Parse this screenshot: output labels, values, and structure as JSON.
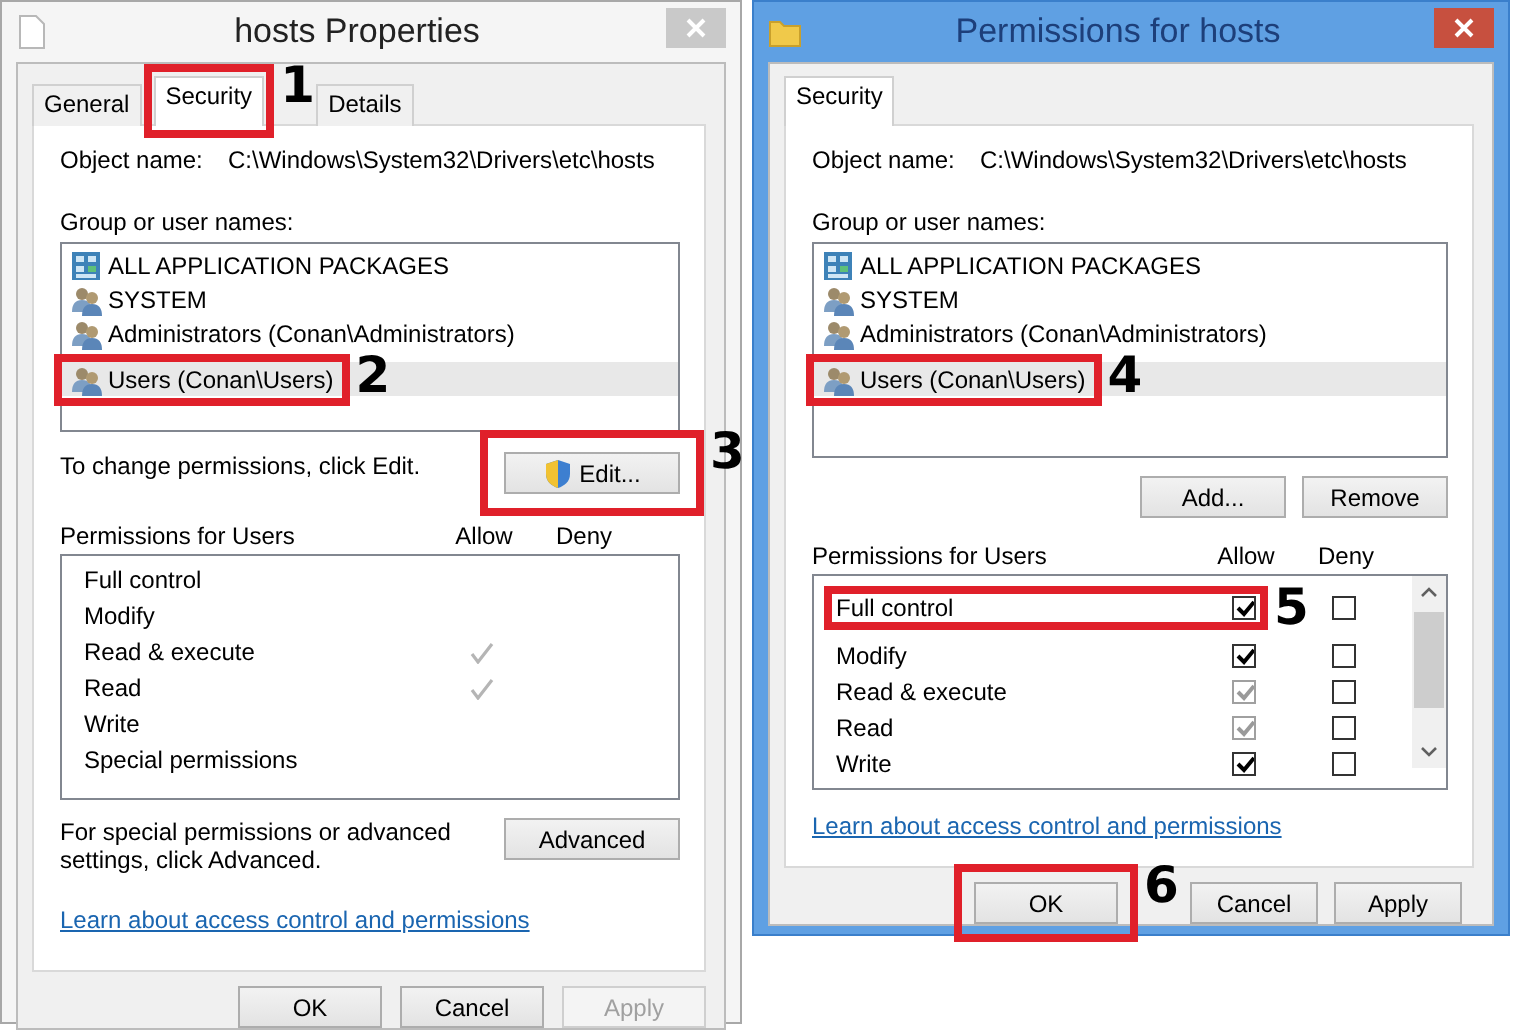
{
  "windows": [
    {
      "kind": "properties",
      "title": "hosts Properties",
      "active": false,
      "tabs": [
        {
          "label": "General",
          "selected": false
        },
        {
          "label": "Security",
          "selected": true,
          "callout": "1"
        },
        {
          "label": "Details",
          "selected": false
        }
      ],
      "object_label": "Object name:",
      "object_path": "C:\\Windows\\System32\\Drivers\\etc\\hosts",
      "groups_label": "Group or user names:",
      "groups": [
        {
          "kind": "packages",
          "name": "ALL APPLICATION PACKAGES",
          "selected": false
        },
        {
          "kind": "user",
          "name": "SYSTEM",
          "selected": false
        },
        {
          "kind": "user",
          "name": "Administrators (Conan\\Administrators)",
          "selected": false
        },
        {
          "kind": "user",
          "name": "Users (Conan\\Users)",
          "selected": true,
          "callout": "2"
        }
      ],
      "group_hint": "To change permissions, click Edit.",
      "group_buttons": [
        {
          "label": "Edit...",
          "shield": true,
          "callout": "3"
        }
      ],
      "permissions_label": "Permissions for Users",
      "allow_label": "Allow",
      "deny_label": "Deny",
      "permissions": [
        {
          "name": "Full control",
          "allow": false
        },
        {
          "name": "Modify",
          "allow": false
        },
        {
          "name": "Read & execute",
          "allow": true
        },
        {
          "name": "Read",
          "allow": true
        },
        {
          "name": "Write",
          "allow": false
        },
        {
          "name": "Special permissions",
          "allow": false
        }
      ],
      "advanced_hint": "For special permissions or advanced settings, click Advanced.",
      "advanced_button": "Advanced",
      "link": "Learn about access control and permissions",
      "footer_buttons": [
        {
          "label": "OK",
          "disabled": false
        },
        {
          "label": "Cancel",
          "disabled": false
        },
        {
          "label": "Apply",
          "disabled": true
        }
      ]
    },
    {
      "kind": "permissions",
      "title": "Permissions for hosts",
      "active": true,
      "tabs": [
        {
          "label": "Security",
          "selected": true
        }
      ],
      "object_label": "Object name:",
      "object_path": "C:\\Windows\\System32\\Drivers\\etc\\hosts",
      "groups_label": "Group or user names:",
      "groups": [
        {
          "kind": "packages",
          "name": "ALL APPLICATION PACKAGES",
          "selected": false
        },
        {
          "kind": "user",
          "name": "SYSTEM",
          "selected": false
        },
        {
          "kind": "user",
          "name": "Administrators (Conan\\Administrators)",
          "selected": false
        },
        {
          "kind": "user",
          "name": "Users (Conan\\Users)",
          "selected": true,
          "callout": "4"
        }
      ],
      "group_buttons": [
        {
          "label": "Add..."
        },
        {
          "label": "Remove"
        }
      ],
      "permissions_label": "Permissions for Users",
      "allow_label": "Allow",
      "deny_label": "Deny",
      "permissions": [
        {
          "name": "Full control",
          "allow": true,
          "allow_disabled": false,
          "deny": false,
          "callout": "5"
        },
        {
          "name": "Modify",
          "allow": true,
          "allow_disabled": false,
          "deny": false
        },
        {
          "name": "Read & execute",
          "allow": true,
          "allow_disabled": true,
          "deny": false
        },
        {
          "name": "Read",
          "allow": true,
          "allow_disabled": true,
          "deny": false
        },
        {
          "name": "Write",
          "allow": true,
          "allow_disabled": false,
          "deny": false
        }
      ],
      "link": "Learn about access control and permissions",
      "footer_buttons": [
        {
          "label": "OK",
          "disabled": false,
          "callout": "6"
        },
        {
          "label": "Cancel",
          "disabled": false
        },
        {
          "label": "Apply",
          "disabled": false
        }
      ]
    }
  ]
}
